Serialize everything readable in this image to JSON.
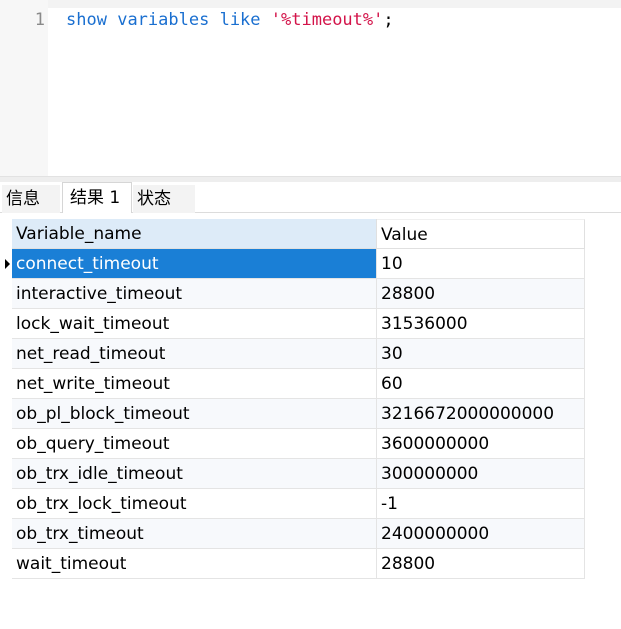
{
  "editor": {
    "line_number": "1",
    "code": {
      "kw1": "show",
      "kw2": "variables",
      "kw3": "like",
      "string": "'%timeout%'",
      "terminator": ";"
    }
  },
  "tabs": [
    {
      "label": "信息"
    },
    {
      "label": "结果 1"
    },
    {
      "label": "状态"
    }
  ],
  "active_tab": "结果 1",
  "grid": {
    "columns": [
      "Variable_name",
      "Value"
    ],
    "selected_row": 0,
    "rows": [
      {
        "name": "connect_timeout",
        "value": "10"
      },
      {
        "name": "interactive_timeout",
        "value": "28800"
      },
      {
        "name": "lock_wait_timeout",
        "value": "31536000"
      },
      {
        "name": "net_read_timeout",
        "value": "30"
      },
      {
        "name": "net_write_timeout",
        "value": "60"
      },
      {
        "name": "ob_pl_block_timeout",
        "value": "3216672000000000"
      },
      {
        "name": "ob_query_timeout",
        "value": "3600000000"
      },
      {
        "name": "ob_trx_idle_timeout",
        "value": "300000000"
      },
      {
        "name": "ob_trx_lock_timeout",
        "value": "-1"
      },
      {
        "name": "ob_trx_timeout",
        "value": "2400000000"
      },
      {
        "name": "wait_timeout",
        "value": "28800"
      }
    ]
  },
  "colors": {
    "keyword": "#1a6fd0",
    "string": "#d3144a",
    "selection": "#1a7fd6",
    "header_selected": "#ddebf8"
  }
}
